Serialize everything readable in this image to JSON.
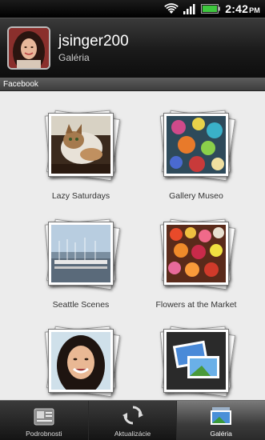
{
  "status_bar": {
    "time": "2:42",
    "ampm": "PM",
    "icons": [
      "wifi-icon",
      "signal-icon",
      "battery-icon"
    ]
  },
  "header": {
    "username": "jsinger200",
    "subtitle": "Galéria"
  },
  "section": {
    "label": "Facebook"
  },
  "albums": [
    {
      "title": "Lazy Saturdays",
      "cover": "cat-photo"
    },
    {
      "title": "Gallery Museo",
      "cover": "glass-art-photo"
    },
    {
      "title": "Seattle Scenes",
      "cover": "marina-photo"
    },
    {
      "title": "Flowers at the Market",
      "cover": "flowers-photo"
    },
    {
      "title": "",
      "cover": "portrait-photo"
    },
    {
      "title": "",
      "cover": "video-placeholder"
    }
  ],
  "tabs": [
    {
      "label": "Podrobnosti",
      "icon": "details-icon",
      "active": false
    },
    {
      "label": "Aktualizácie",
      "icon": "refresh-icon",
      "active": false
    },
    {
      "label": "Galéria",
      "icon": "gallery-icon",
      "active": true
    }
  ],
  "colors": {
    "accent_bg": "#ececec",
    "tab_active": "#7a7a7a"
  }
}
